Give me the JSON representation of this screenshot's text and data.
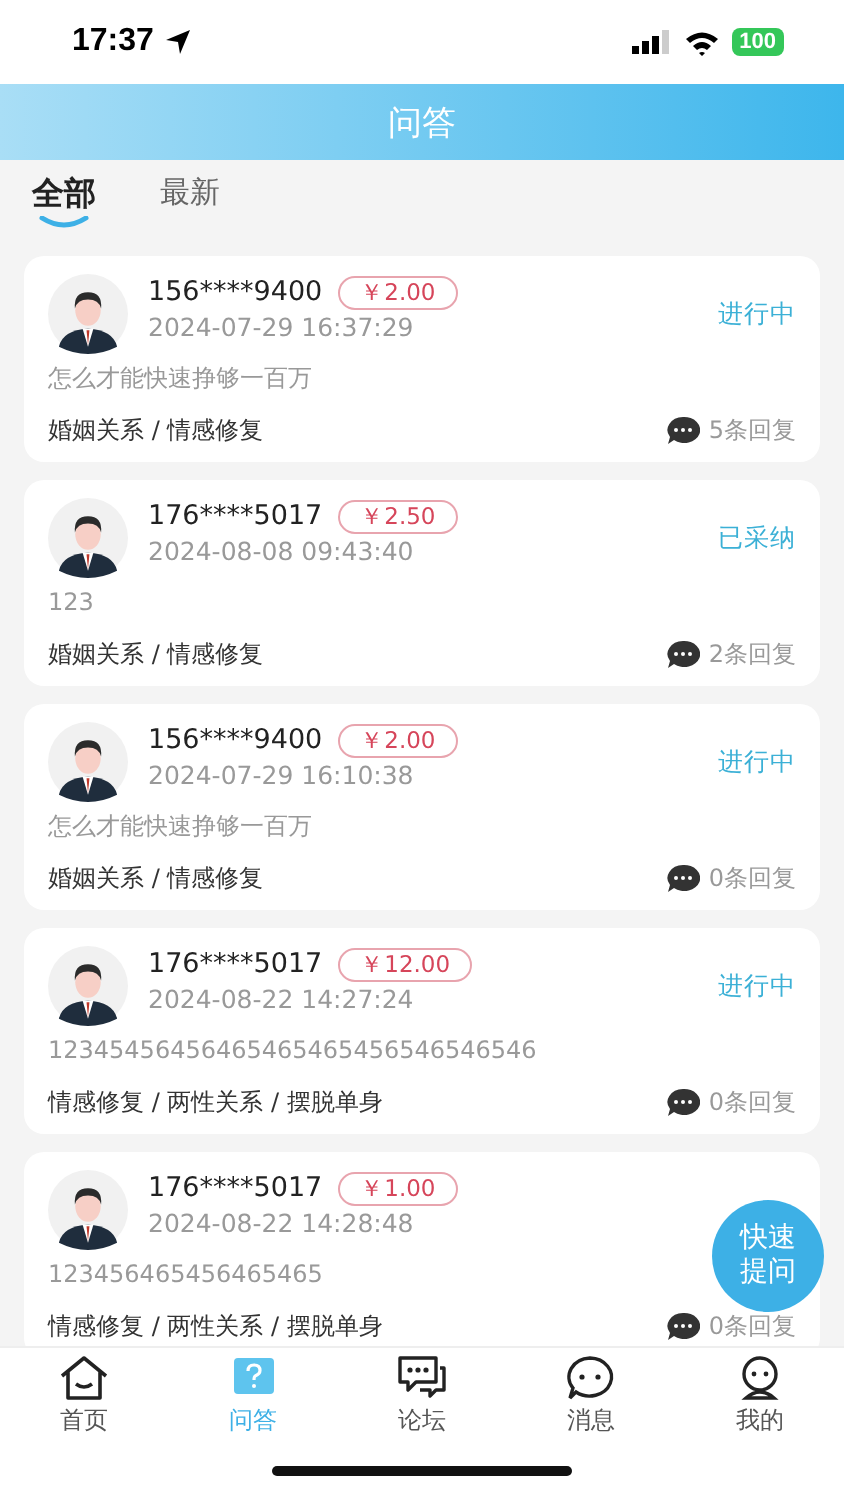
{
  "status_bar": {
    "time": "17:37",
    "battery": "100"
  },
  "header": {
    "title": "问答"
  },
  "tabs": [
    {
      "label": "全部",
      "selected": true
    },
    {
      "label": "最新",
      "selected": false
    }
  ],
  "questions": [
    {
      "user": "156****9400",
      "reward": "￥2.00",
      "time": "2024-07-29 16:37:29",
      "status": "进行中",
      "content": "怎么才能快速挣够一百万",
      "tags": "婚姻关系 / 情感修复",
      "replies": "5条回复"
    },
    {
      "user": "176****5017",
      "reward": "￥2.50",
      "time": "2024-08-08 09:43:40",
      "status": "已采纳",
      "content": "123",
      "tags": "婚姻关系 / 情感修复",
      "replies": "2条回复"
    },
    {
      "user": "156****9400",
      "reward": "￥2.00",
      "time": "2024-07-29 16:10:38",
      "status": "进行中",
      "content": "怎么才能快速挣够一百万",
      "tags": "婚姻关系 / 情感修复",
      "replies": "0条回复"
    },
    {
      "user": "176****5017",
      "reward": "￥12.00",
      "time": "2024-08-22 14:27:24",
      "status": "进行中",
      "content": "12345456456465465465456546546546",
      "tags": "情感修复 / 两性关系 / 摆脱单身",
      "replies": "0条回复"
    },
    {
      "user": "176****5017",
      "reward": "￥1.00",
      "time": "2024-08-22 14:28:48",
      "content": "123456465456465465",
      "tags": "情感修复 / 两性关系 / 摆脱单身",
      "replies": "0条回复"
    }
  ],
  "quick_ask": {
    "label": "快速提问"
  },
  "nav": [
    {
      "label": "首页",
      "selected": false
    },
    {
      "label": "问答",
      "selected": true
    },
    {
      "label": "论坛",
      "selected": false
    },
    {
      "label": "消息",
      "selected": false
    },
    {
      "label": "我的",
      "selected": false
    }
  ]
}
